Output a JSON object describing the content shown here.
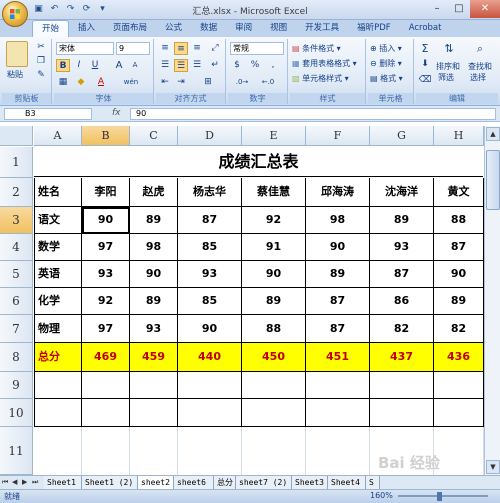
{
  "window": {
    "title": "汇总.xlsx - Microsoft Excel"
  },
  "tabs": [
    "开始",
    "插入",
    "页面布局",
    "公式",
    "数据",
    "审阅",
    "视图",
    "开发工具",
    "福昕PDF",
    "Acrobat"
  ],
  "ribbon": {
    "clipboard": {
      "paste": "粘贴",
      "label": "剪贴板"
    },
    "font": {
      "name": "宋体",
      "size": "9",
      "bold": "B",
      "italic": "I",
      "underline": "U",
      "grow": "A",
      "shrink": "A",
      "font_color_letter": "A",
      "phonetic": "wén",
      "label": "字体"
    },
    "alignment": {
      "label": "对齐方式"
    },
    "number": {
      "format": "常规",
      "percent": "%",
      "comma": ",",
      "currency": "$",
      "label": "数字"
    },
    "styles": {
      "conditional": "条件格式",
      "table": "套用表格格式",
      "cell": "单元格样式",
      "label": "样式"
    },
    "cells": {
      "insert": "插入",
      "delete": "删除",
      "format": "格式",
      "label": "单元格"
    },
    "editing": {
      "sum": "Σ",
      "sort": "排序和",
      "sort2": "筛选",
      "find": "查找和",
      "find2": "选择",
      "label": "编辑"
    }
  },
  "formula_bar": {
    "name_box": "B3",
    "fx": "fx",
    "value": "90"
  },
  "columns": [
    "A",
    "B",
    "C",
    "D",
    "E",
    "F",
    "G",
    "H",
    "I"
  ],
  "rows": [
    "1",
    "2",
    "3",
    "4",
    "5",
    "6",
    "7",
    "8",
    "9",
    "10",
    "11"
  ],
  "sheet": {
    "title": "成绩汇总表",
    "header": [
      "姓名",
      "李阳",
      "赵虎",
      "杨志华",
      "蔡佳慧",
      "邱海涛",
      "沈海洋",
      "黄文"
    ],
    "subjects": [
      {
        "name": "语文",
        "scores": [
          "90",
          "89",
          "87",
          "92",
          "98",
          "89",
          "88"
        ]
      },
      {
        "name": "数学",
        "scores": [
          "97",
          "98",
          "85",
          "91",
          "90",
          "93",
          "87"
        ]
      },
      {
        "name": "英语",
        "scores": [
          "93",
          "90",
          "93",
          "90",
          "89",
          "87",
          "90"
        ]
      },
      {
        "name": "化学",
        "scores": [
          "92",
          "89",
          "85",
          "89",
          "87",
          "86",
          "89"
        ]
      },
      {
        "name": "物理",
        "scores": [
          "97",
          "93",
          "90",
          "88",
          "87",
          "82",
          "82"
        ]
      }
    ],
    "total": {
      "name": "总分",
      "scores": [
        "469",
        "459",
        "440",
        "450",
        "451",
        "437",
        "436"
      ]
    }
  },
  "sheet_tabs": [
    "Sheet1",
    "Sheet1 (2)",
    "sheet2",
    "sheet6",
    "总分",
    "sheet7 (2)",
    "Sheet3",
    "Sheet4",
    "S"
  ],
  "active_sheet": "sheet2",
  "status": {
    "mode": "就绪",
    "zoom": "160%"
  },
  "watermark": "Bai 经验"
}
